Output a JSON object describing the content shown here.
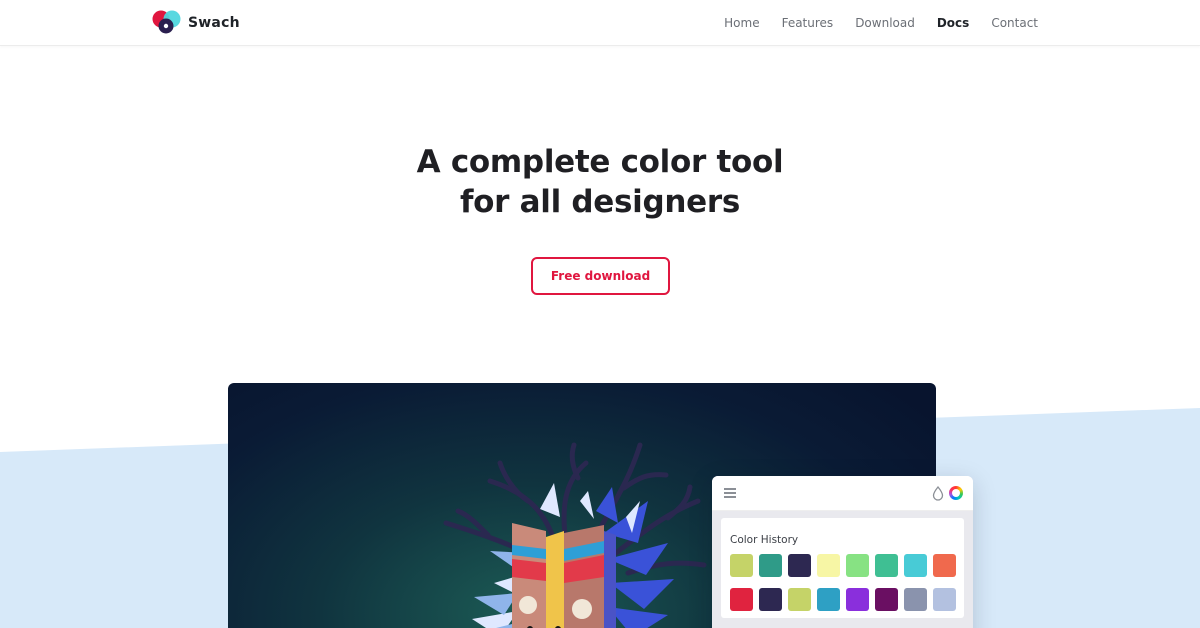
{
  "brand": {
    "name": "Swach",
    "logo_icon": "swach-logo-icon"
  },
  "nav": {
    "links": [
      {
        "label": "Home",
        "active": false
      },
      {
        "label": "Features",
        "active": false
      },
      {
        "label": "Download",
        "active": false
      },
      {
        "label": "Docs",
        "active": true
      },
      {
        "label": "Contact",
        "active": false
      }
    ]
  },
  "hero": {
    "title_line1": "A complete color tool",
    "title_line2": "for all designers",
    "cta_label": "Free download"
  },
  "app_panel": {
    "menu_icon": "hamburger-menu-icon",
    "drop_icon": "color-drop-icon",
    "wheel_icon": "color-wheel-icon",
    "section_title": "Color History",
    "swatches": [
      "#c5d368",
      "#2f9b88",
      "#2d2851",
      "#f7f6a5",
      "#87e283",
      "#3fbf93",
      "#48cbd6",
      "#f0694d",
      "#e0233f",
      "#2d2851",
      "#c5d368",
      "#2ea0c4",
      "#8a2fdc",
      "#6a0f62",
      "#8a93ad",
      "#b3c1e0"
    ]
  },
  "colors": {
    "accent": "#e0163f",
    "hero_text": "#1f1f23",
    "backdrop_blue": "#d7e9f9",
    "screen_dark": "#0a1b35"
  }
}
